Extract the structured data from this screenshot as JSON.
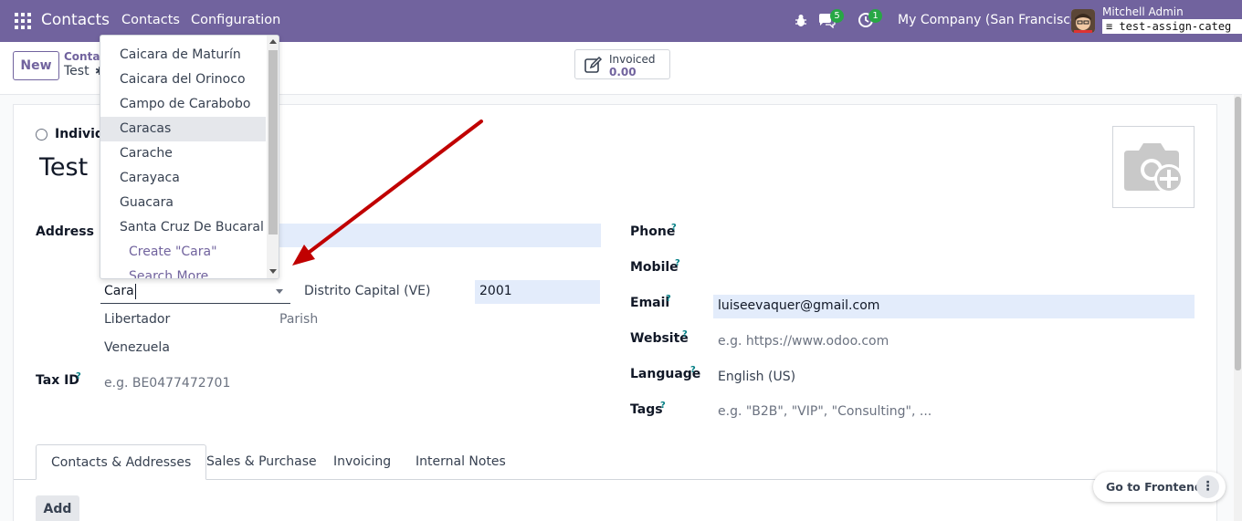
{
  "navbar": {
    "app_name": "Contacts",
    "menus": [
      "Contacts",
      "Configuration"
    ],
    "messages_count": "5",
    "activities_count": "1",
    "company": "My Company (San Francisco)",
    "user_name": "Mitchell Admin",
    "database": "test-assign-categ",
    "color": "#71639e"
  },
  "control_panel": {
    "new_label": "New",
    "breadcrumb": "Contacts",
    "record_title": "Test",
    "stat_button": {
      "label": "Invoiced",
      "value": "0.00",
      "icon": "pencil-square-icon"
    }
  },
  "form": {
    "company_type_label": "Individual",
    "name": "Test",
    "address_label": "Address",
    "city_value": "Cara",
    "state_value": "Distrito Capital (VE)",
    "zip_value": "2001",
    "municipality_value": "Libertador",
    "parish_placeholder": "Parish",
    "country_value": "Venezuela",
    "tax_id_label": "Tax ID",
    "tax_id_placeholder": "e.g. BE0477472701",
    "phone_label": "Phone",
    "mobile_label": "Mobile",
    "email_label": "Email",
    "email_value": "luiseevaquer@gmail.com",
    "website_label": "Website",
    "website_placeholder": "e.g. https://www.odoo.com",
    "language_label": "Language",
    "language_value": "English (US)",
    "tags_label": "Tags",
    "tags_placeholder": "e.g. \"B2B\", \"VIP\", \"Consulting\", ...",
    "help_mark": "?"
  },
  "city_dropdown": {
    "items": [
      "Caicara de Maturín",
      "Caicara del Orinoco",
      "Campo de Carabobo",
      "Caracas",
      "Carache",
      "Carayaca",
      "Guacara",
      "Santa Cruz De Bucaral"
    ],
    "active_item": "Caracas",
    "create_label": "Create \"Cara\"",
    "search_more_label": "Search More..."
  },
  "tabs": [
    "Contacts & Addresses",
    "Sales & Purchase",
    "Invoicing",
    "Internal Notes"
  ],
  "add_label": "Add",
  "frontend_label": "Go to Frontend",
  "annotation_color": "#c00000"
}
